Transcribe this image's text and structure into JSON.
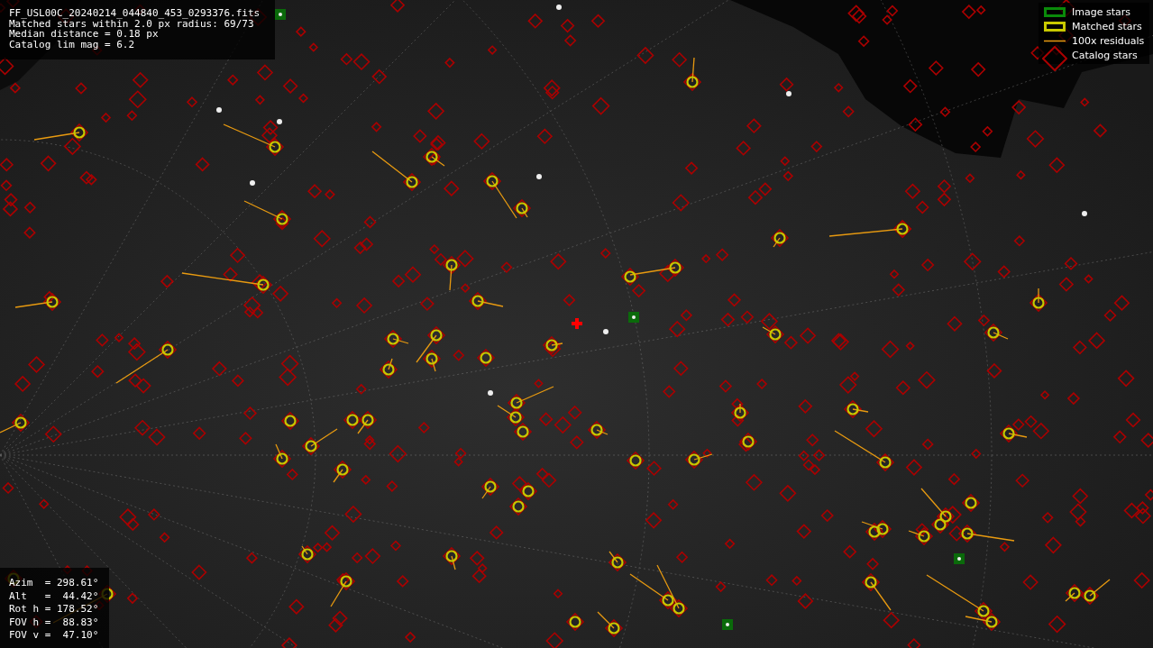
{
  "info": {
    "lines": [
      "FF_USL00C_20240214_044840_453_0293376.fits",
      "Matched stars within 2.0 px radius: 69/73",
      "Median distance = 0.18 px",
      "Catalog lim mag = 6.2"
    ]
  },
  "legend": [
    {
      "label": "Image stars",
      "kind": "image"
    },
    {
      "label": "Matched stars",
      "kind": "matched"
    },
    {
      "label": "100x residuals",
      "kind": "residual"
    },
    {
      "label": "Catalog stars",
      "kind": "catalog"
    }
  ],
  "pointing": {
    "lines": [
      "Azim  = 298.61°",
      "Alt   =  44.42°",
      "Rot h = 178.52°",
      "FOV h =  88.83°",
      "FOV v =  47.10°"
    ]
  }
}
